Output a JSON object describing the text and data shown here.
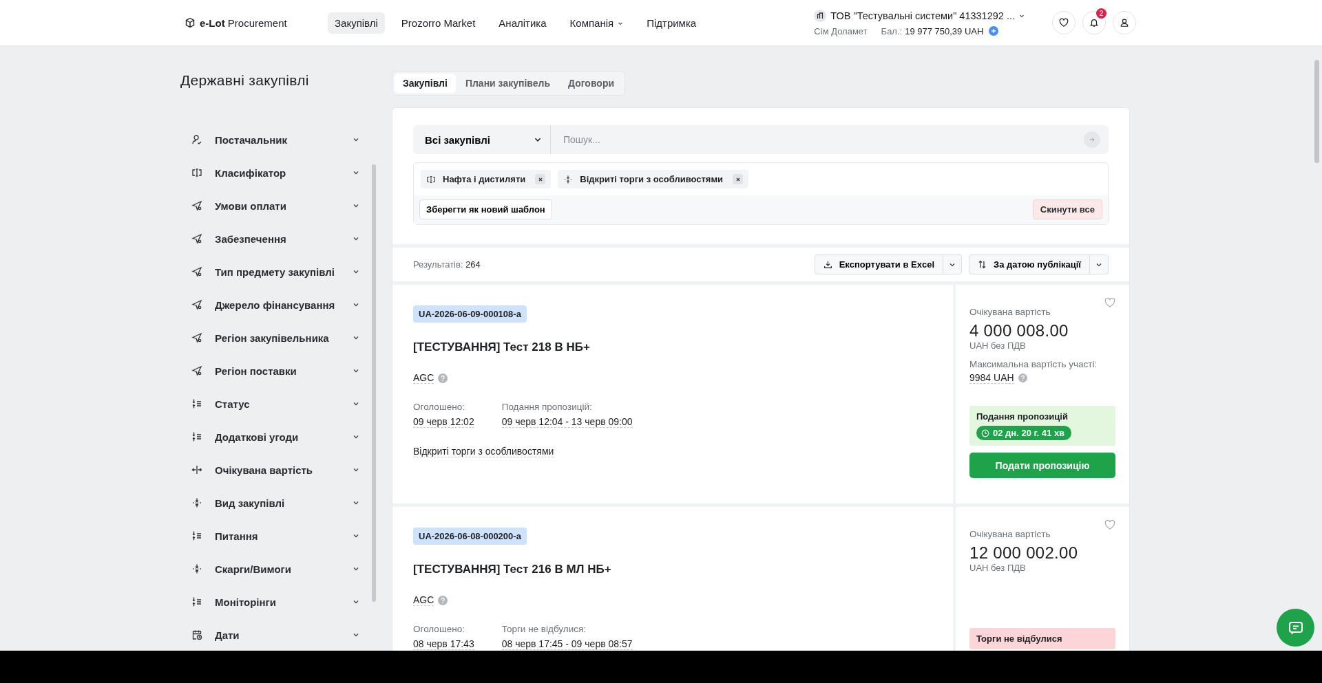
{
  "header": {
    "logo": "**e-Lot** Procurement",
    "nav": [
      {
        "label": "Закупівлі",
        "selected": true,
        "dropdown": false
      },
      {
        "label": "Prozorro Market",
        "selected": false,
        "dropdown": false
      },
      {
        "label": "Аналітика",
        "selected": false,
        "dropdown": false
      },
      {
        "label": "Компанія",
        "selected": false,
        "dropdown": true
      },
      {
        "label": "Підтримка",
        "selected": false,
        "dropdown": false
      }
    ],
    "company": "ТОВ \"Тестувальні системи\" 41331292 ...",
    "user": "Сім Доламет",
    "balance_label": "Бал.:",
    "balance": "19 977 750,39 UAH",
    "notifications": "2"
  },
  "sidebar": {
    "title": "Державні закупівлі",
    "filters": [
      {
        "label": "Постачальник",
        "kind": "user"
      },
      {
        "label": "Класифікатор",
        "kind": "classifier"
      },
      {
        "label": "Умови оплати",
        "kind": "send"
      },
      {
        "label": "Забезпечення",
        "kind": "send"
      },
      {
        "label": "Тип предмету закупівлі",
        "kind": "send"
      },
      {
        "label": "Джерело фінансування",
        "kind": "send"
      },
      {
        "label": "Регіон закупівельника",
        "kind": "send"
      },
      {
        "label": "Регіон поставки",
        "kind": "send"
      },
      {
        "label": "Статус",
        "kind": "list"
      },
      {
        "label": "Додаткові угоди",
        "kind": "list"
      },
      {
        "label": "Очікувана вартість",
        "kind": "range"
      },
      {
        "label": "Вид закупівлі",
        "kind": "merge"
      },
      {
        "label": "Питання",
        "kind": "list"
      },
      {
        "label": "Скарги/Вимоги",
        "kind": "merge"
      },
      {
        "label": "Моніторінги",
        "kind": "list"
      },
      {
        "label": "Дати",
        "kind": "calendar"
      }
    ]
  },
  "tabs": [
    {
      "label": "Закупівлі",
      "selected": true
    },
    {
      "label": "Плани закупівель",
      "selected": false
    },
    {
      "label": "Договори",
      "selected": false
    }
  ],
  "search": {
    "scope": "Всі закупівлі",
    "placeholder": "Пошук..."
  },
  "chips": [
    {
      "label": "Нафта і дистиляти",
      "kind": "classifier"
    },
    {
      "label": "Відкриті торги з особливостями",
      "kind": "merge"
    }
  ],
  "save_template": "Зберегти як новий шаблон",
  "reset": "Скинути все",
  "results": {
    "label": "Результатів:",
    "count": "264",
    "export": "Експортувати в Excel",
    "sort": "За датою публікації"
  },
  "tenders": [
    {
      "id": "UA-2026-06-09-000108-a",
      "title": "[ТЕСТУВАННЯ] Тест 218 В НБ+",
      "buyer": "AGC",
      "announced_label": "Оголошено:",
      "announced": "09 черв 12:02",
      "period_label": "Подання пропозицій:",
      "period": "09 черв 12:04 - 13 черв 09:00",
      "procedure": "Відкриті торги з особливостями",
      "value_label": "Очікувана вартість",
      "amount": "4 000 008.00",
      "currency": "UAH без ПДВ",
      "max_label": "Максимальна вартість участі:",
      "max_value": "9984 UAH",
      "status": "Подання пропозицій",
      "kind": "active",
      "timer": "02 дн. 20 г. 41 хв",
      "action": "Подати пропозицію"
    },
    {
      "id": "UA-2026-06-08-000200-a",
      "title": "[ТЕСТУВАННЯ] Тест 216 В МЛ НБ+",
      "buyer": "AGC",
      "announced_label": "Оголошено:",
      "announced": "08 черв 17:43",
      "period_label": "Торги не відбулися:",
      "period": "08 черв 17:45 - 09 черв 08:57",
      "value_label": "Очікувана вартість",
      "amount": "12 000 002.00",
      "currency": "UAH без ПДВ",
      "status": "Торги не відбулися",
      "kind": "failed"
    }
  ]
}
